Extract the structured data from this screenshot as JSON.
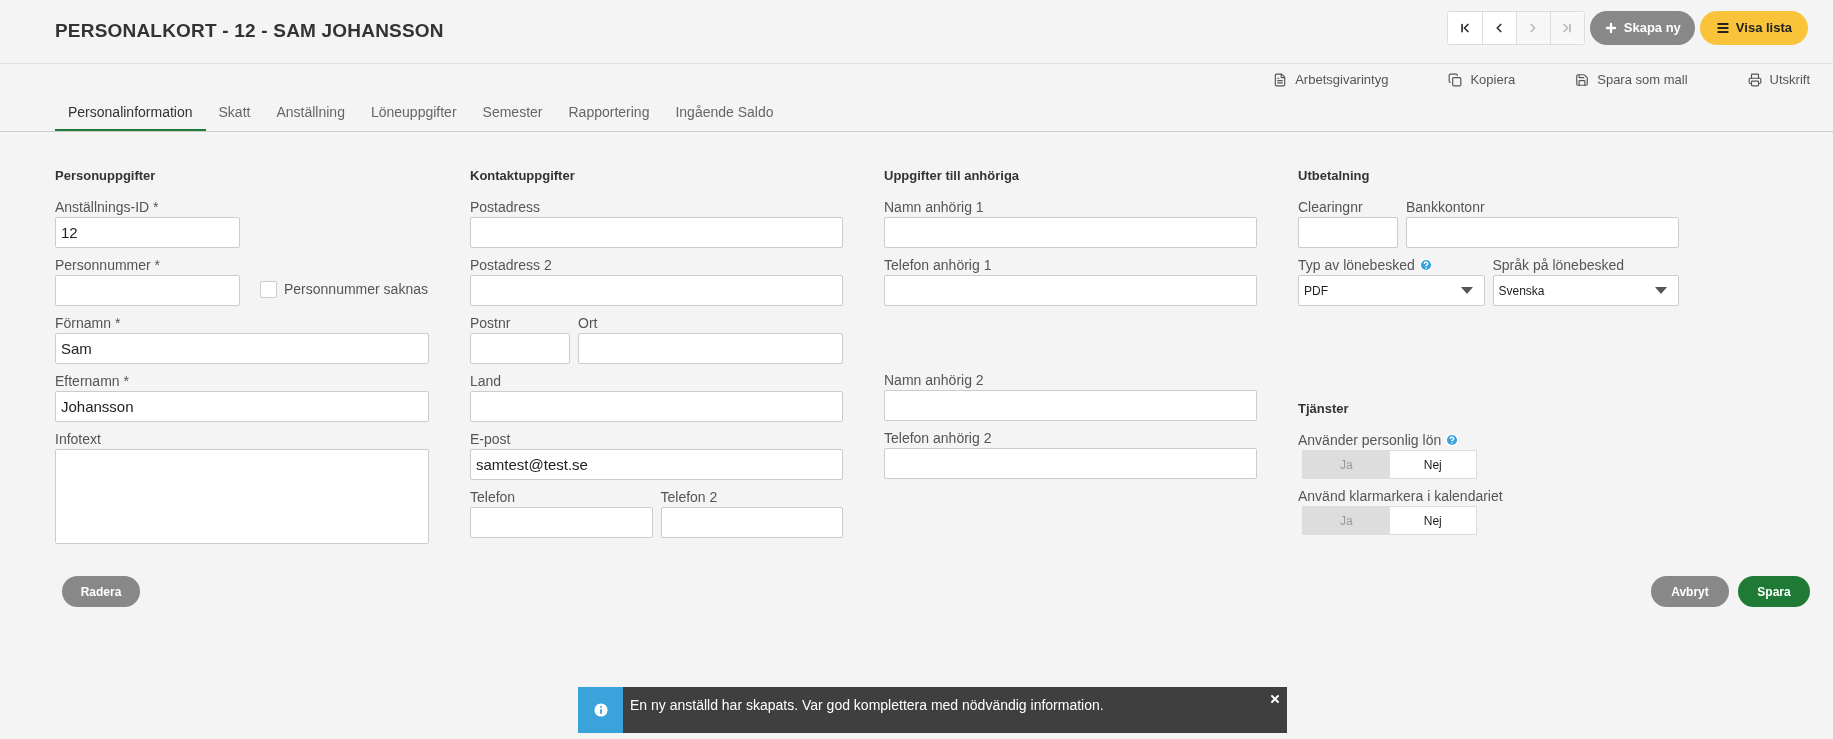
{
  "header": {
    "title": "PERSONALKORT - 12 - SAM JOHANSSON",
    "nav_buttons": [
      {
        "kind": "first",
        "disabled": false
      },
      {
        "kind": "previous",
        "disabled": false
      },
      {
        "kind": "next",
        "disabled": true
      },
      {
        "kind": "last",
        "disabled": true
      }
    ],
    "actions": [
      {
        "kind": "create",
        "label": "Skapa ny"
      },
      {
        "kind": "list",
        "label": "Visa lista"
      }
    ]
  },
  "toolbar": [
    {
      "kind": "document",
      "label": "Arbetsgivarintyg"
    },
    {
      "kind": "copy",
      "label": "Kopiera"
    },
    {
      "kind": "save",
      "label": "Spara som mall"
    },
    {
      "kind": "print",
      "label": "Utskrift"
    }
  ],
  "tabs": [
    {
      "label": "Personalinformation",
      "selected": true
    },
    {
      "label": "Skatt",
      "selected": false
    },
    {
      "label": "Anställning",
      "selected": false
    },
    {
      "label": "Löneuppgifter",
      "selected": false
    },
    {
      "label": "Semester",
      "selected": false
    },
    {
      "label": "Rapportering",
      "selected": false
    },
    {
      "label": "Ingående Saldo",
      "selected": false
    }
  ],
  "columns": [
    {
      "groups": [
        {
          "heading": "Personuppgifter",
          "rows": [
            [
              {
                "kind": "short_input",
                "label": "Anställnings-ID *",
                "value": "12"
              }
            ],
            [
              {
                "kind": "short_input",
                "label": "Personnummer *"
              },
              {
                "kind": "checkbox",
                "label": "Personnummer saknas",
                "checked": false
              }
            ],
            [
              {
                "kind": "input",
                "label": "Förnamn *",
                "value": "Sam"
              }
            ],
            [
              {
                "kind": "input",
                "label": "Efternamn *",
                "value": "Johansson"
              }
            ],
            [
              {
                "kind": "textarea",
                "label": "Infotext"
              }
            ]
          ]
        }
      ]
    },
    {
      "groups": [
        {
          "heading": "Kontaktuppgifter",
          "rows": [
            [
              {
                "kind": "input",
                "label": "Postadress"
              }
            ],
            [
              {
                "kind": "input",
                "label": "Postadress 2"
              }
            ],
            [
              {
                "kind": "short_input",
                "label": "Postnr"
              },
              {
                "kind": "input",
                "label": "Ort"
              }
            ],
            [
              {
                "kind": "input",
                "label": "Land"
              }
            ],
            [
              {
                "kind": "input",
                "label": "E-post",
                "value": "samtest@test.se"
              }
            ],
            [
              {
                "kind": "input",
                "label": "Telefon"
              },
              {
                "kind": "input",
                "label": "Telefon 2"
              }
            ]
          ]
        }
      ]
    },
    {
      "groups": [
        {
          "heading": "Uppgifter till anhöriga",
          "rows": [
            [
              {
                "kind": "input",
                "label": "Namn anhörig 1"
              }
            ],
            [
              {
                "kind": "input",
                "label": "Telefon anhörig 1"
              }
            ]
          ]
        },
        {
          "rows": [
            [
              {
                "kind": "input",
                "label": "Namn anhörig 2"
              }
            ],
            [
              {
                "kind": "input",
                "label": "Telefon anhörig 2"
              }
            ]
          ]
        }
      ]
    },
    {
      "groups": [
        {
          "heading": "Utbetalning",
          "rows": [
            [
              {
                "kind": "short_input",
                "label": "Clearingnr"
              },
              {
                "kind": "input",
                "label": "Bankkontonr"
              }
            ],
            [
              {
                "kind": "select",
                "label": "Typ av lönebesked",
                "help": true,
                "value": "PDF"
              },
              {
                "kind": "select",
                "label": "Språk på lönebesked",
                "value": "Svenska"
              }
            ]
          ]
        },
        {
          "heading": "Tjänster",
          "rows": [
            [
              {
                "kind": "toggle",
                "label": "Använder personlig lön",
                "help": true,
                "options": [
                  {
                    "label": "Ja",
                    "selected": false
                  },
                  {
                    "label": "Nej",
                    "selected": true
                  }
                ]
              }
            ],
            [
              {
                "kind": "toggle",
                "label": "Använd klarmarkera i kalendariet",
                "options": [
                  {
                    "label": "Ja",
                    "selected": false
                  },
                  {
                    "label": "Nej",
                    "selected": true
                  }
                ]
              }
            ]
          ]
        }
      ]
    }
  ],
  "footer": {
    "delete": "Radera",
    "cancel": "Avbryt",
    "save": "Spara"
  },
  "notification": {
    "message": "En ny anställd har skapats. Var god komplettera med nödvändig information."
  }
}
